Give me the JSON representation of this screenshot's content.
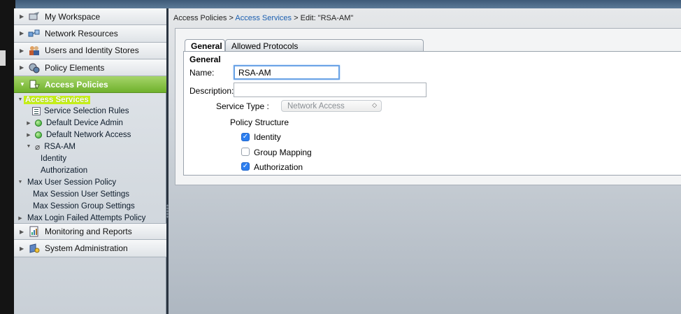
{
  "sidebar": {
    "drawers_top": [
      {
        "label": "My Workspace",
        "icon": "workspace-icon"
      },
      {
        "label": "Network Resources",
        "icon": "network-resources-icon"
      },
      {
        "label": "Users and Identity Stores",
        "icon": "users-icon"
      },
      {
        "label": "Policy Elements",
        "icon": "policy-elements-icon"
      },
      {
        "label": "Access Policies",
        "icon": "access-policies-icon"
      }
    ],
    "tree": {
      "access_services": "Access Services",
      "service_selection_rules": "Service Selection Rules",
      "default_device_admin": "Default Device Admin",
      "default_network_access": "Default Network Access",
      "rsa_am": "RSA-AM",
      "identity": "Identity",
      "authorization": "Authorization",
      "max_user_session_policy": "Max User Session Policy",
      "max_session_user_settings": "Max Session User Settings",
      "max_session_group_settings": "Max Session Group Settings",
      "max_login_failed": "Max Login Failed Attempts Policy"
    },
    "drawers_bottom": [
      {
        "label": "Monitoring and Reports",
        "icon": "monitoring-icon"
      },
      {
        "label": "System Administration",
        "icon": "system-admin-icon"
      }
    ]
  },
  "breadcrumb": {
    "part1": "Access Policies",
    "sep1": " > ",
    "part2": "Access Services",
    "sep2": " > ",
    "part3": "Edit: \"RSA-AM\""
  },
  "tabs": {
    "general": "General",
    "allowed_protocols": "Allowed Protocols"
  },
  "form": {
    "section_title": "General",
    "name_label": "Name:",
    "name_value": "RSA-AM",
    "description_label": "Description:",
    "description_value": "",
    "service_type_label": "Service Type :",
    "service_type_value": "Network Access",
    "policy_structure_label": "Policy Structure",
    "identity_label": "Identity",
    "group_mapping_label": "Group Mapping",
    "authorization_label": "Authorization"
  },
  "colors": {
    "active_drawer": "#6fb12c",
    "selected_tree": "#c6ef1a",
    "link": "#1b5fb0",
    "checkbox": "#2d7ff0"
  }
}
